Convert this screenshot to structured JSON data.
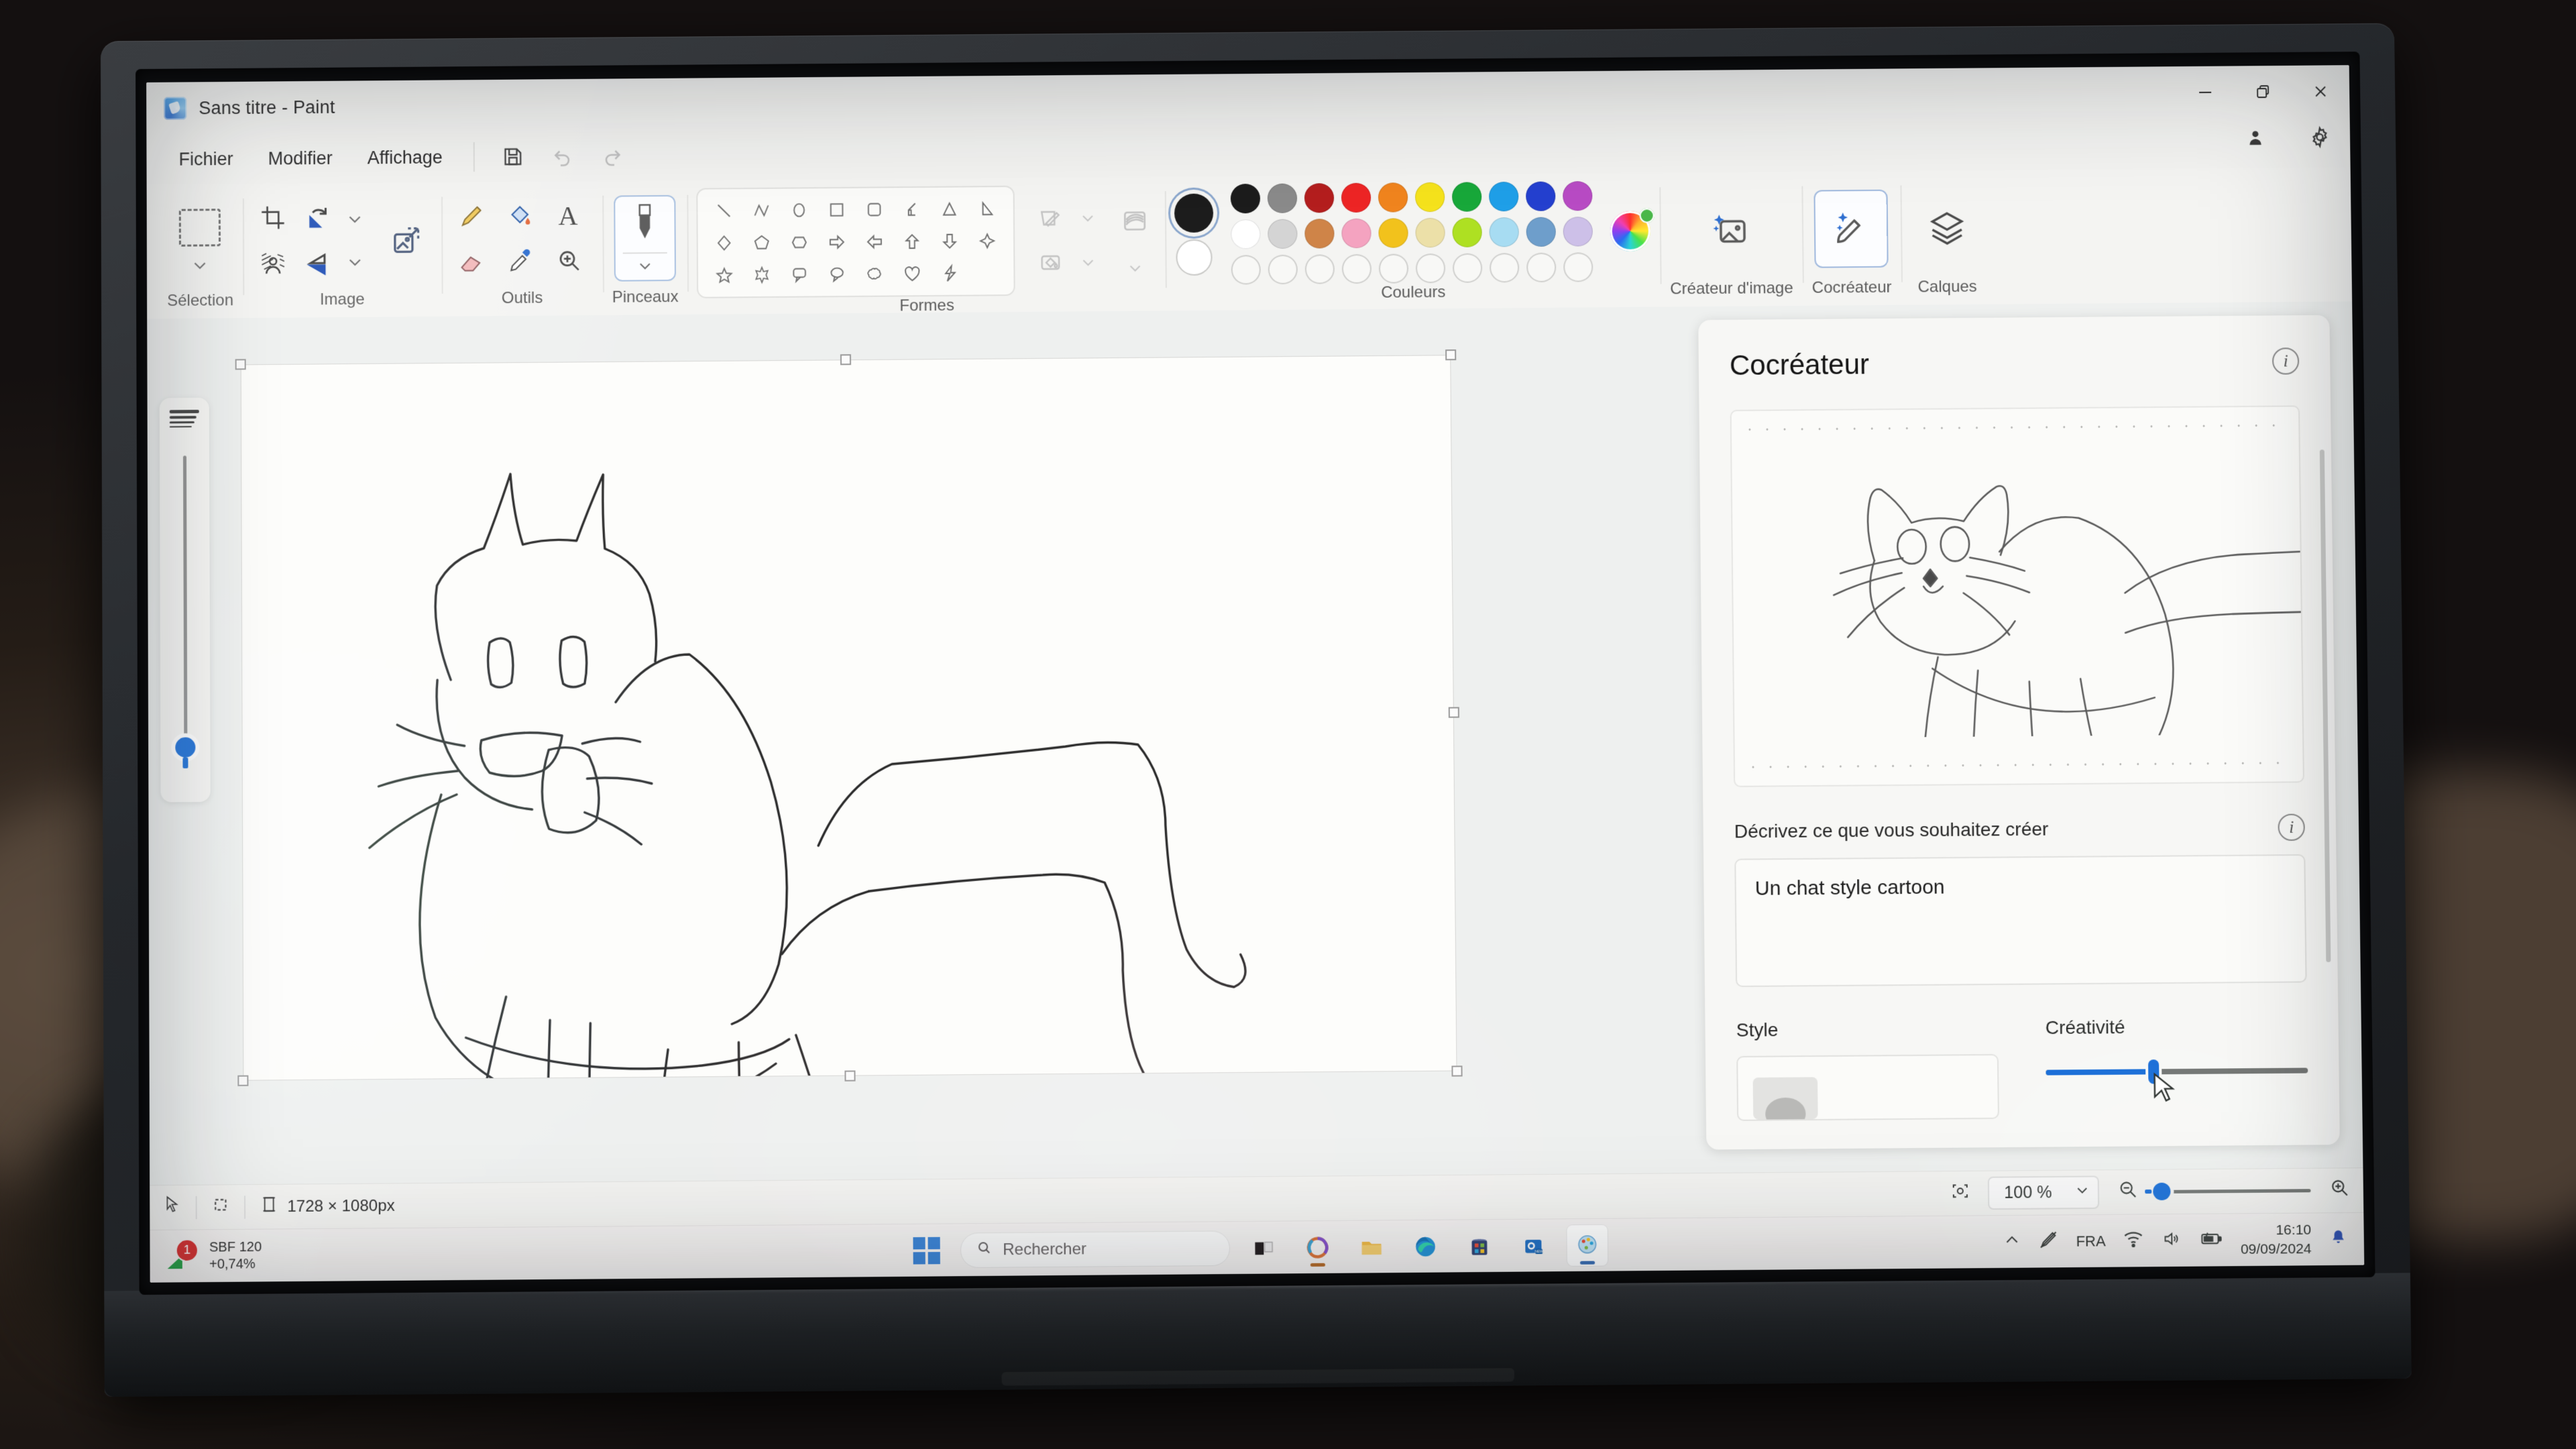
{
  "window": {
    "title": "Sans titre - Paint",
    "app_icon": "paint-app-icon",
    "controls": {
      "minimize": "—",
      "restore": "❐",
      "close": "✕"
    }
  },
  "menubar": {
    "items": [
      {
        "label": "Fichier"
      },
      {
        "label": "Modifier"
      },
      {
        "label": "Affichage"
      }
    ],
    "quick_actions": [
      {
        "name": "save-icon",
        "glyph": "save"
      },
      {
        "name": "undo-icon",
        "glyph": "undo"
      },
      {
        "name": "redo-icon",
        "glyph": "redo"
      }
    ],
    "right_icons": [
      {
        "name": "account-icon"
      },
      {
        "name": "settings-gear-icon"
      }
    ]
  },
  "ribbon": {
    "groups": [
      {
        "name": "selection",
        "label": "Sélection",
        "tools": [
          {
            "name": "rectangular-selection-tool"
          },
          {
            "name": "selection-dropdown"
          }
        ]
      },
      {
        "name": "image",
        "label": "Image",
        "tools": [
          {
            "name": "crop-tool"
          },
          {
            "name": "rotate-tool"
          },
          {
            "name": "rotate-dropdown"
          },
          {
            "name": "remove-background-tool"
          },
          {
            "name": "flip-tool"
          },
          {
            "name": "flip-dropdown"
          },
          {
            "name": "resize-image-tool"
          }
        ]
      },
      {
        "name": "tools",
        "label": "Outils",
        "tools": [
          {
            "name": "pencil-tool"
          },
          {
            "name": "fill-bucket-tool"
          },
          {
            "name": "text-tool"
          },
          {
            "name": "eraser-tool"
          },
          {
            "name": "color-picker-tool"
          },
          {
            "name": "magnifier-tool"
          }
        ]
      },
      {
        "name": "brushes",
        "label": "Pinceaux",
        "tools": [
          {
            "name": "brushes-tool",
            "selected": true
          },
          {
            "name": "brushes-dropdown"
          }
        ]
      },
      {
        "name": "shapes",
        "label": "Formes",
        "items": [
          "line",
          "curve",
          "oval",
          "rectangle",
          "rounded-rectangle",
          "right-triangle-4",
          "triangle",
          "right-triangle",
          "diamond",
          "pentagon",
          "hexagon",
          "arrow-right",
          "arrow-left",
          "arrow-up",
          "arrow-down",
          "four-point-star",
          "five-point-star",
          "six-point-star",
          "speech-bubble-rect",
          "speech-bubble-oval",
          "cloud-callout",
          "heart",
          "lightning"
        ],
        "outline_tools": [
          {
            "name": "shape-outline-tool"
          },
          {
            "name": "shape-outline-dropdown"
          },
          {
            "name": "shape-fill-tool"
          },
          {
            "name": "shape-fill-dropdown"
          },
          {
            "name": "shape-stroke-style-tool"
          },
          {
            "name": "shape-stroke-dropdown"
          }
        ]
      },
      {
        "name": "colors",
        "label": "Couleurs",
        "primary_color": "#1c1c1c",
        "secondary_color": "#ffffff",
        "row1": [
          "#1c1c1c",
          "#8a8a8a",
          "#b41e1e",
          "#ed2525",
          "#f0841e",
          "#f5e21c",
          "#18a83a",
          "#1f9fe8",
          "#2440cf",
          "#b84bc4"
        ],
        "row2": [
          "#ffffff",
          "#d4d4d4",
          "#cf8448",
          "#f4a3c0",
          "#f2c21c",
          "#ece0a8",
          "#aee022",
          "#a7dcf2",
          "#6e9ecb",
          "#cdc0e8"
        ],
        "row3_empty_count": 10,
        "color_wheel": "color-wheel-icon"
      },
      {
        "name": "image-creator",
        "label": "Créateur d'image",
        "icon": "image-creator-sparkle-icon"
      },
      {
        "name": "cocreator",
        "label": "Cocréateur",
        "icon": "cocreator-brush-sparkle-icon",
        "active": true
      },
      {
        "name": "layers",
        "label": "Calques",
        "icon": "layers-stack-icon"
      }
    ]
  },
  "canvas": {
    "brush_size_slider": {
      "name": "brush-size-slider",
      "value_pct": 86
    },
    "drawing_alt": "hand-drawn cat sketch",
    "resize_handles": 8
  },
  "cocreator_panel": {
    "title": "Cocréateur",
    "info_icon": "info-icon",
    "preview_alt": "AI generated cartoon cat preview",
    "prompt_label": "Décrivez ce que vous souhaitez créer",
    "prompt_info_icon": "info-icon",
    "prompt_value": "Un chat style cartoon",
    "prompt_placeholder": "Décrivez ce que vous souhaitez créer",
    "style_label": "Style",
    "creativity_label": "Créativité",
    "creativity_value_pct": 39
  },
  "statusbar": {
    "cursor_icon": "cursor-arrow-icon",
    "selection_icon": "selection-size-icon",
    "canvas_icon": "canvas-size-icon",
    "canvas_size": "1728 × 1080px",
    "fit_icon": "fit-to-window-icon",
    "zoom_value": "100 %",
    "zoom_dropdown_icon": "chevron-down-icon",
    "zoom_out_icon": "zoom-out-icon",
    "zoom_in_icon": "zoom-in-icon",
    "zoom_slider_pct": 4
  },
  "taskbar": {
    "stock_widget": {
      "badge": "1",
      "name": "SBF 120",
      "change": "+0,74%"
    },
    "start_icon": "windows-start-icon",
    "search": {
      "icon": "search-icon",
      "placeholder": "Rechercher"
    },
    "apps": [
      {
        "name": "task-view-icon"
      },
      {
        "name": "copilot-icon"
      },
      {
        "name": "file-explorer-icon"
      },
      {
        "name": "edge-icon"
      },
      {
        "name": "microsoft-store-icon"
      },
      {
        "name": "outlook-new-icon"
      },
      {
        "name": "paint-icon",
        "active": true
      }
    ],
    "tray": {
      "overflow_icon": "chevron-up-icon",
      "pen_off_icon": "pen-disabled-icon",
      "language": "FRA",
      "wifi_icon": "wifi-icon",
      "volume_icon": "volume-icon",
      "battery_icon": "battery-charging-icon",
      "time": "16:10",
      "date": "09/09/2024",
      "notification_icon": "notification-bell-icon"
    }
  }
}
